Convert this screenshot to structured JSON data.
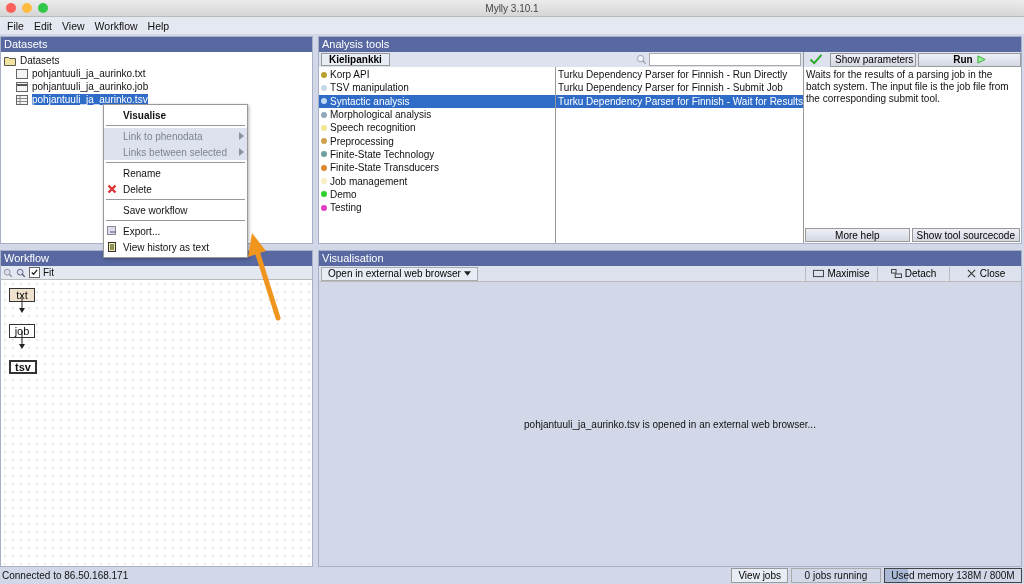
{
  "window": {
    "title": "Mylly 3.10.1"
  },
  "menu": [
    "File",
    "Edit",
    "View",
    "Workflow",
    "Help"
  ],
  "datasets": {
    "title": "Datasets",
    "root": "Datasets",
    "files": [
      {
        "name": "pohjantuuli_ja_aurinko.txt",
        "kind": "text",
        "selected": false
      },
      {
        "name": "pohjantuuli_ja_aurinko.job",
        "kind": "job",
        "selected": false
      },
      {
        "name": "pohjantuuli_ja_aurinko.tsv",
        "kind": "table",
        "selected": true
      }
    ]
  },
  "context_menu": [
    {
      "label": "Visualise",
      "kind": "bold",
      "disabled": false
    },
    {
      "kind": "separator"
    },
    {
      "label": "Link to phenodata",
      "kind": "submenu",
      "disabled": true
    },
    {
      "label": "Links between selected",
      "kind": "submenu",
      "disabled": true
    },
    {
      "kind": "separator"
    },
    {
      "label": "Rename",
      "kind": "item",
      "disabled": false
    },
    {
      "label": "Delete",
      "kind": "delete",
      "disabled": false
    },
    {
      "kind": "separator"
    },
    {
      "label": "Save workflow",
      "kind": "item",
      "disabled": false
    },
    {
      "kind": "separator"
    },
    {
      "label": "Export...",
      "kind": "export",
      "disabled": false
    },
    {
      "label": "View history as text",
      "kind": "history",
      "disabled": false
    }
  ],
  "analysis_tools": {
    "title": "Analysis tools",
    "module_tab": "Kielipankki",
    "show_parameters": "Show parameters",
    "run": "Run",
    "categories": [
      {
        "name": "Korp API",
        "color": "#b8a030",
        "selected": false
      },
      {
        "name": "TSV manipulation",
        "color": "#c8d8e8",
        "selected": false
      },
      {
        "name": "Syntactic analysis",
        "color": "#c0d8f0",
        "selected": true
      },
      {
        "name": "Morphological analysis",
        "color": "#90a8b8",
        "selected": false
      },
      {
        "name": "Speech recognition",
        "color": "#f0e890",
        "selected": false
      },
      {
        "name": "Preprocessing",
        "color": "#d0a050",
        "selected": false
      },
      {
        "name": "Finite-State Technology",
        "color": "#70a0a0",
        "selected": false
      },
      {
        "name": "Finite-State Transducers",
        "color": "#e08830",
        "selected": false
      },
      {
        "name": "Job management",
        "color": "#f8f0c0",
        "selected": false
      },
      {
        "name": "Demo",
        "color": "#30d030",
        "selected": false
      },
      {
        "name": "Testing",
        "color": "#e040c0",
        "selected": false
      }
    ],
    "tools": [
      {
        "name": "Turku Dependency Parser for Finnish - Run Directly",
        "selected": false
      },
      {
        "name": "Turku Dependency Parser for Finnish - Submit Job",
        "selected": false
      },
      {
        "name": "Turku Dependency Parser for Finnish - Wait for Results",
        "selected": true
      }
    ],
    "description": "Waits for the results of a parsing job in the batch system. The input file is the job file from the corresponding submit tool.",
    "more_help": "More help",
    "show_source": "Show tool sourcecode"
  },
  "workflow": {
    "title": "Workflow",
    "fit_label": "Fit",
    "fit_checked": true,
    "nodes": [
      {
        "label": "txt",
        "selected": false
      },
      {
        "label": "job",
        "selected": false
      },
      {
        "label": "tsv",
        "selected": true
      }
    ]
  },
  "visualisation": {
    "title": "Visualisation",
    "method": "Open in external web browser",
    "maximise": "Maximise",
    "detach": "Detach",
    "close": "Close",
    "message": "pohjantuuli_ja_aurinko.tsv is opened in an external web browser..."
  },
  "status_bar": {
    "connection": "Connected to 86.50.168.171",
    "view_jobs": "View jobs",
    "jobs_running": "0 jobs running",
    "memory": {
      "label": "Used memory 138M / 800M",
      "level": 0.17
    }
  }
}
